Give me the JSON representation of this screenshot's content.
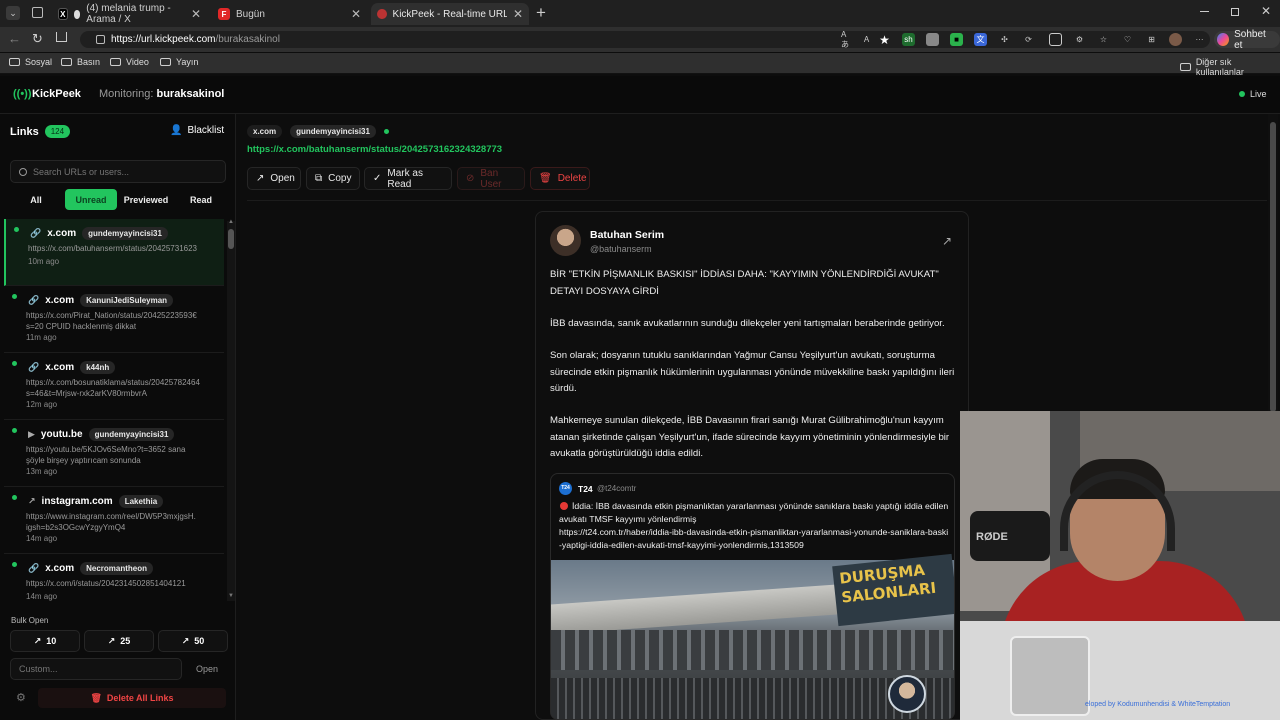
{
  "browser": {
    "tabs": [
      {
        "label": "(4) melania trump - Arama / X"
      },
      {
        "label": "Bugün"
      },
      {
        "label": "KickPeek - Real-time URL Crawler"
      }
    ],
    "url_host": "https://url.kickpeek.com",
    "url_path": "/burakasakinol",
    "bookmarks": [
      "Sosyal",
      "Basın",
      "Video",
      "Yayın"
    ],
    "other_bookmarks": "Diğer sık kullanılanlar",
    "copilot": "Sohbet et"
  },
  "app": {
    "logo": "KickPeek",
    "monitoring_label": "Monitoring:",
    "monitoring_user": "buraksakinol",
    "live": "Live"
  },
  "sidebar": {
    "title": "Links",
    "count": "124",
    "blacklist": "Blacklist",
    "search_placeholder": "Search URLs or users...",
    "filters": [
      "All",
      "Unread",
      "Previewed",
      "Read"
    ],
    "active_filter": "Unread",
    "items": [
      {
        "domain": "x.com",
        "user": "gundemyayincisi31",
        "url": "https://x.com/batuhanserm/status/20425731623",
        "time": "10m ago",
        "icon": "x-link-icon"
      },
      {
        "domain": "x.com",
        "user": "KanuniJediSuleyman",
        "url": "https://x.com/Pirat_Nation/status/20425223593€\ns=20 CPUID hacklenmiş dikkat",
        "time": "11m ago",
        "icon": "x-link-icon"
      },
      {
        "domain": "x.com",
        "user": "k44nh",
        "url": "https://x.com/bosunatiklama/status/20425782464\ns=46&t=Mrjsw-rxk2arKV80rmbvrA",
        "time": "12m ago",
        "icon": "x-link-icon"
      },
      {
        "domain": "youtu.be",
        "user": "gundemyayincisi31",
        "url": "https://youtu.be/5KJOv6SeMno?t=3652 sana\nşöyle birşey yaptırıcam sonunda",
        "time": "13m ago",
        "icon": "youtube-icon"
      },
      {
        "domain": "instagram.com",
        "user": "Lakethia",
        "url": "https://www.instagram.com/reel/DW5P3mxjgsH.\nigsh=b2s3OGcwYzgyYmQ4",
        "time": "14m ago",
        "icon": "external-link-icon"
      },
      {
        "domain": "x.com",
        "user": "Necromantheon",
        "url": "https://x.com/i/status/2042314502851404121",
        "time": "14m ago",
        "icon": "x-link-icon"
      }
    ],
    "bulk_title": "Bulk Open",
    "bulk": [
      "10",
      "25",
      "50"
    ],
    "custom_placeholder": "Custom...",
    "open": "Open",
    "delete_all": "Delete All Links"
  },
  "detail": {
    "domain": "x.com",
    "user": "gundemyayincisi31",
    "url": "https://x.com/batuhanserm/status/2042573162324328773",
    "actions": {
      "open": "Open",
      "copy": "Copy",
      "mark_read": "Mark as Read",
      "ban": "Ban User",
      "delete": "Delete"
    }
  },
  "tweet": {
    "name": "Batuhan Serim",
    "handle": "@batuhanserm",
    "paragraphs": [
      "BİR \"ETKİN PİŞMANLIK BASKISI\" İDDİASI DAHA: \"KAYYIMIN YÖNLENDİRDİĞİ AVUKAT\" DETAYI DOSYAYA GİRDİ",
      "İBB davasında, sanık avukatlarının sunduğu dilekçeler yeni tartışmaları beraberinde getiriyor.",
      "Son olarak; dosyanın tutuklu sanıklarından Yağmur Cansu Yeşilyurt'un avukatı, soruşturma sürecinde etkin pişmanlık hükümlerinin uygulanması yönünde müvekkiline baskı yapıldığını ileri sürdü.",
      "Mahkemeye sunulan dilekçede, İBB Davasının firari sanığı Murat Gülibrahimoğlu'nun kayyım atanan şirketinde çalışan Yeşilyurt'un, ifade sürecinde kayyım yönetiminin yönlendirmesiyle bir avukatla görüştürüldüğü iddia edildi."
    ],
    "quote": {
      "name": "T24",
      "handle": "@t24comtr",
      "logo": "T24",
      "text": "İddia: İBB davasında etkin pişmanlıktan yararlanması yönünde sanıklara baskı yaptığı iddia edilen avukatı TMSF kayyımı yönlendirmiş",
      "link": "https://t24.com.tr/haber/iddia-ibb-davasinda-etkin-pismanliktan-yararlanmasi-yonunde-saniklara-baski-yaptigi-iddia-edilen-avukati-tmsf-kayyimi-yonlendirmis,1313509",
      "image_sign": "DURUŞMA\nSALONLARI"
    }
  },
  "overlay": {
    "mic_brand": "RØDE",
    "credit": "eloped by Kodumunhendisi & WhiteTemptation"
  },
  "colors": {
    "accent": "#22c55e",
    "danger": "#ef4444",
    "bg": "#0a0a0a"
  }
}
